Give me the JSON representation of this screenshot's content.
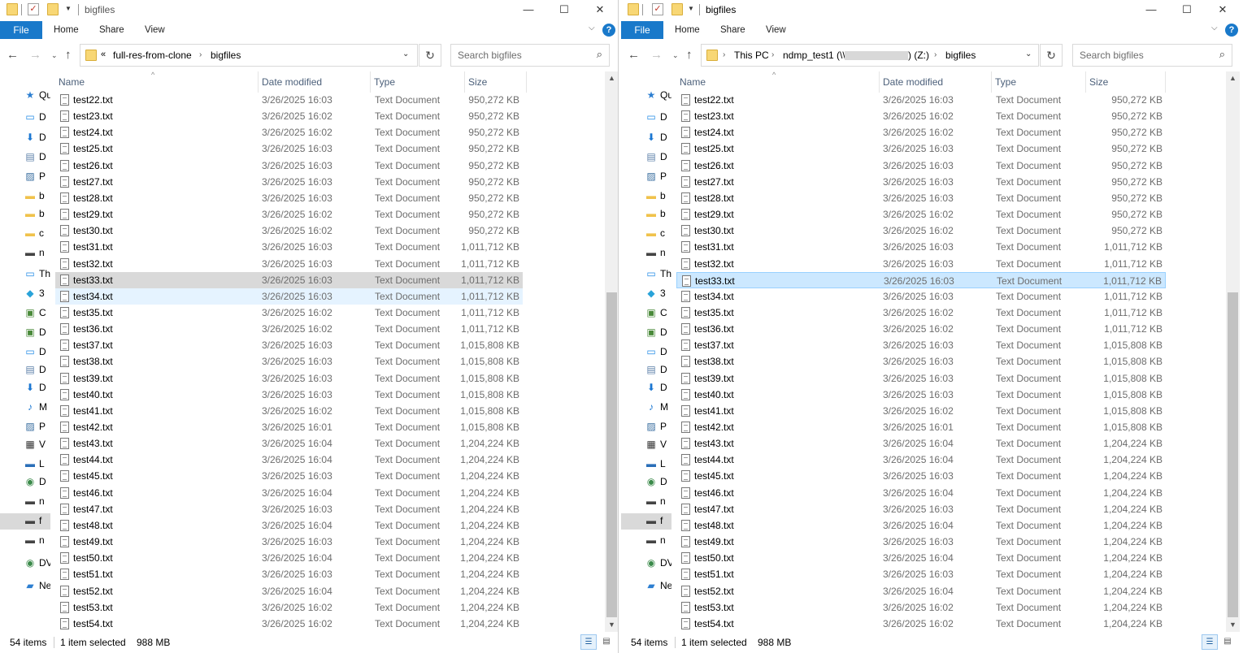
{
  "colors": {
    "accent": "#1979ca",
    "selected_grey": "#d9d9d9",
    "selected_blue": "#cce8ff",
    "hover": "#e5f3ff",
    "header_text": "#4c607a",
    "meta_text": "#6d6d6d"
  },
  "left": {
    "title": "bigfiles",
    "ribbon": {
      "file": "File",
      "home": "Home",
      "share": "Share",
      "view": "View"
    },
    "address": {
      "overflow": "«",
      "crumbs": [
        "full-res-from-clone",
        "bigfiles"
      ]
    },
    "search_placeholder": "Search bigfiles",
    "nav": [
      {
        "icon": "star-icon",
        "label": "Qu"
      },
      {
        "icon": "desktop-icon",
        "label": "D"
      },
      {
        "icon": "download-icon",
        "label": "D"
      },
      {
        "icon": "document-icon",
        "label": "D"
      },
      {
        "icon": "pictures-icon",
        "label": "P"
      },
      {
        "icon": "folder-icon",
        "label": "b"
      },
      {
        "icon": "folder-icon",
        "label": "b"
      },
      {
        "icon": "folder-icon",
        "label": "c"
      },
      {
        "icon": "network-drive-icon",
        "label": "n"
      },
      {
        "icon": "pc-icon",
        "label": "Th"
      },
      {
        "icon": "3d-objects-icon",
        "label": "3"
      },
      {
        "icon": "drive-icon",
        "label": "C"
      },
      {
        "icon": "drive-icon",
        "label": "D"
      },
      {
        "icon": "desktop-icon",
        "label": "D"
      },
      {
        "icon": "document-icon",
        "label": "D"
      },
      {
        "icon": "download-icon",
        "label": "D"
      },
      {
        "icon": "music-icon",
        "label": "M"
      },
      {
        "icon": "pictures-icon",
        "label": "P"
      },
      {
        "icon": "video-icon",
        "label": "V"
      },
      {
        "icon": "local-disk-icon",
        "label": "L"
      },
      {
        "icon": "dvd-icon",
        "label": "D"
      },
      {
        "icon": "network-drive-icon",
        "label": "n"
      },
      {
        "icon": "network-drive-icon",
        "label": "f"
      },
      {
        "icon": "network-drive-icon",
        "label": "n"
      },
      {
        "icon": "dvd-icon",
        "label": "DV"
      },
      {
        "icon": "network-icon",
        "label": "Ne"
      }
    ],
    "columns": {
      "name": "Name",
      "date": "Date modified",
      "type": "Type",
      "size": "Size"
    },
    "status": {
      "count": "54 items",
      "selected": "1 item selected",
      "size": "988 MB"
    }
  },
  "right": {
    "title": "bigfiles",
    "ribbon": {
      "file": "File",
      "home": "Home",
      "share": "Share",
      "view": "View"
    },
    "address": {
      "crumbs": [
        "This PC",
        "ndmp_test1 (\\\\",
        ") (Z:)",
        "bigfiles"
      ]
    },
    "search_placeholder": "Search bigfiles",
    "columns": {
      "name": "Name",
      "date": "Date modified",
      "type": "Type",
      "size": "Size"
    },
    "status": {
      "count": "54 items",
      "selected": "1 item selected",
      "size": "988 MB"
    }
  },
  "files": [
    {
      "name": "test22.txt",
      "date": "3/26/2025 16:03",
      "type": "Text Document",
      "size": "950,272 KB"
    },
    {
      "name": "test23.txt",
      "date": "3/26/2025 16:02",
      "type": "Text Document",
      "size": "950,272 KB"
    },
    {
      "name": "test24.txt",
      "date": "3/26/2025 16:02",
      "type": "Text Document",
      "size": "950,272 KB"
    },
    {
      "name": "test25.txt",
      "date": "3/26/2025 16:03",
      "type": "Text Document",
      "size": "950,272 KB"
    },
    {
      "name": "test26.txt",
      "date": "3/26/2025 16:03",
      "type": "Text Document",
      "size": "950,272 KB"
    },
    {
      "name": "test27.txt",
      "date": "3/26/2025 16:03",
      "type": "Text Document",
      "size": "950,272 KB"
    },
    {
      "name": "test28.txt",
      "date": "3/26/2025 16:03",
      "type": "Text Document",
      "size": "950,272 KB"
    },
    {
      "name": "test29.txt",
      "date": "3/26/2025 16:02",
      "type": "Text Document",
      "size": "950,272 KB"
    },
    {
      "name": "test30.txt",
      "date": "3/26/2025 16:02",
      "type": "Text Document",
      "size": "950,272 KB"
    },
    {
      "name": "test31.txt",
      "date": "3/26/2025 16:03",
      "type": "Text Document",
      "size": "1,011,712 KB"
    },
    {
      "name": "test32.txt",
      "date": "3/26/2025 16:03",
      "type": "Text Document",
      "size": "1,011,712 KB"
    },
    {
      "name": "test33.txt",
      "date": "3/26/2025 16:03",
      "type": "Text Document",
      "size": "1,011,712 KB"
    },
    {
      "name": "test34.txt",
      "date": "3/26/2025 16:03",
      "type": "Text Document",
      "size": "1,011,712 KB"
    },
    {
      "name": "test35.txt",
      "date": "3/26/2025 16:02",
      "type": "Text Document",
      "size": "1,011,712 KB"
    },
    {
      "name": "test36.txt",
      "date": "3/26/2025 16:02",
      "type": "Text Document",
      "size": "1,011,712 KB"
    },
    {
      "name": "test37.txt",
      "date": "3/26/2025 16:03",
      "type": "Text Document",
      "size": "1,015,808 KB"
    },
    {
      "name": "test38.txt",
      "date": "3/26/2025 16:03",
      "type": "Text Document",
      "size": "1,015,808 KB"
    },
    {
      "name": "test39.txt",
      "date": "3/26/2025 16:03",
      "type": "Text Document",
      "size": "1,015,808 KB"
    },
    {
      "name": "test40.txt",
      "date": "3/26/2025 16:03",
      "type": "Text Document",
      "size": "1,015,808 KB"
    },
    {
      "name": "test41.txt",
      "date": "3/26/2025 16:02",
      "type": "Text Document",
      "size": "1,015,808 KB"
    },
    {
      "name": "test42.txt",
      "date": "3/26/2025 16:01",
      "type": "Text Document",
      "size": "1,015,808 KB"
    },
    {
      "name": "test43.txt",
      "date": "3/26/2025 16:04",
      "type": "Text Document",
      "size": "1,204,224 KB"
    },
    {
      "name": "test44.txt",
      "date": "3/26/2025 16:04",
      "type": "Text Document",
      "size": "1,204,224 KB"
    },
    {
      "name": "test45.txt",
      "date": "3/26/2025 16:03",
      "type": "Text Document",
      "size": "1,204,224 KB"
    },
    {
      "name": "test46.txt",
      "date": "3/26/2025 16:04",
      "type": "Text Document",
      "size": "1,204,224 KB"
    },
    {
      "name": "test47.txt",
      "date": "3/26/2025 16:03",
      "type": "Text Document",
      "size": "1,204,224 KB"
    },
    {
      "name": "test48.txt",
      "date": "3/26/2025 16:04",
      "type": "Text Document",
      "size": "1,204,224 KB"
    },
    {
      "name": "test49.txt",
      "date": "3/26/2025 16:03",
      "type": "Text Document",
      "size": "1,204,224 KB"
    },
    {
      "name": "test50.txt",
      "date": "3/26/2025 16:04",
      "type": "Text Document",
      "size": "1,204,224 KB"
    },
    {
      "name": "test51.txt",
      "date": "3/26/2025 16:03",
      "type": "Text Document",
      "size": "1,204,224 KB"
    },
    {
      "name": "test52.txt",
      "date": "3/26/2025 16:04",
      "type": "Text Document",
      "size": "1,204,224 KB"
    },
    {
      "name": "test53.txt",
      "date": "3/26/2025 16:02",
      "type": "Text Document",
      "size": "1,204,224 KB"
    },
    {
      "name": "test54.txt",
      "date": "3/26/2025 16:02",
      "type": "Text Document",
      "size": "1,204,224 KB"
    }
  ],
  "selected_file": "test33.txt",
  "hover_file_left": "test34.txt"
}
